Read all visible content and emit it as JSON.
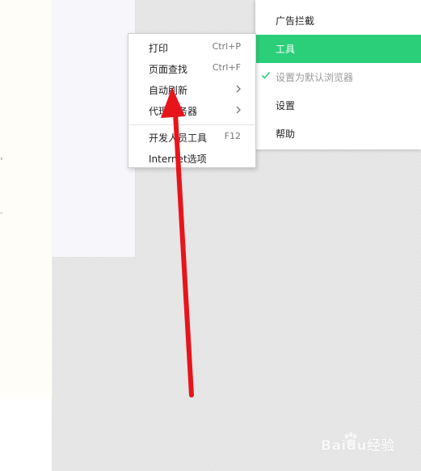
{
  "main_menu": {
    "items": [
      {
        "label": "广告拦截",
        "state": "normal"
      },
      {
        "label": "工具",
        "state": "active"
      },
      {
        "label": "设置为默认浏览器",
        "state": "disabled",
        "checked": true
      },
      {
        "label": "设置",
        "state": "normal"
      },
      {
        "label": "帮助",
        "state": "normal"
      }
    ]
  },
  "tools_submenu": {
    "items": [
      {
        "label": "打印",
        "shortcut": "Ctrl+P"
      },
      {
        "label": "页面查找",
        "shortcut": "Ctrl+F"
      },
      {
        "label": "自动刷新",
        "has_submenu": true
      },
      {
        "label": "代理服务器",
        "has_submenu": true
      },
      {
        "label": "开发人员工具",
        "shortcut": "F12"
      },
      {
        "label": "Internet选项"
      }
    ]
  },
  "annotation": {
    "arrow_color": "#e8141b"
  },
  "watermark": {
    "text": "Baidu经验"
  },
  "colors": {
    "accent": "#2bcf7a",
    "background": "#e4e4e4"
  }
}
